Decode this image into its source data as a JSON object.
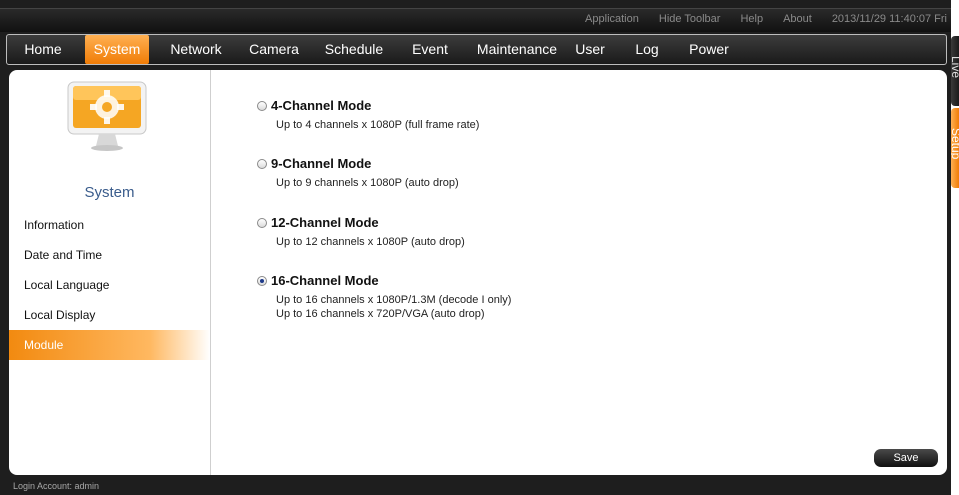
{
  "toolbar": {
    "links": [
      "Application",
      "Hide Toolbar",
      "Help",
      "About"
    ],
    "datetime": "2013/11/29 11:40:07 Fri"
  },
  "nav": {
    "items": [
      "Home",
      "System",
      "Network",
      "Camera",
      "Schedule",
      "Event",
      "Maintenance",
      "User",
      "Log",
      "Power"
    ],
    "active": "System"
  },
  "sidebar": {
    "title": "System",
    "items": [
      "Information",
      "Date and Time",
      "Local Language",
      "Local Display",
      "Module"
    ],
    "active": "Module"
  },
  "modes": [
    {
      "label": "4-Channel Mode",
      "desc": [
        "Up to 4 channels x 1080P (full frame rate)"
      ],
      "checked": false
    },
    {
      "label": "9-Channel Mode",
      "desc": [
        "Up to 9 channels x 1080P (auto drop)"
      ],
      "checked": false
    },
    {
      "label": "12-Channel Mode",
      "desc": [
        "Up to 12 channels x 1080P (auto drop)"
      ],
      "checked": false
    },
    {
      "label": "16-Channel Mode",
      "desc": [
        "Up to 16 channels x 1080P/1.3M (decode I only)",
        "Up to 16 channels x 720P/VGA (auto drop)"
      ],
      "checked": true
    }
  ],
  "save_label": "Save",
  "status": "Login Account: admin",
  "side_tabs": {
    "live": "Live",
    "setup": "Setup"
  },
  "colors": {
    "accent": "#f07c06",
    "title_blue": "#3a5c8c",
    "dark": "#1e1e1e"
  },
  "icons": {
    "system": "monitor-gear-icon"
  }
}
